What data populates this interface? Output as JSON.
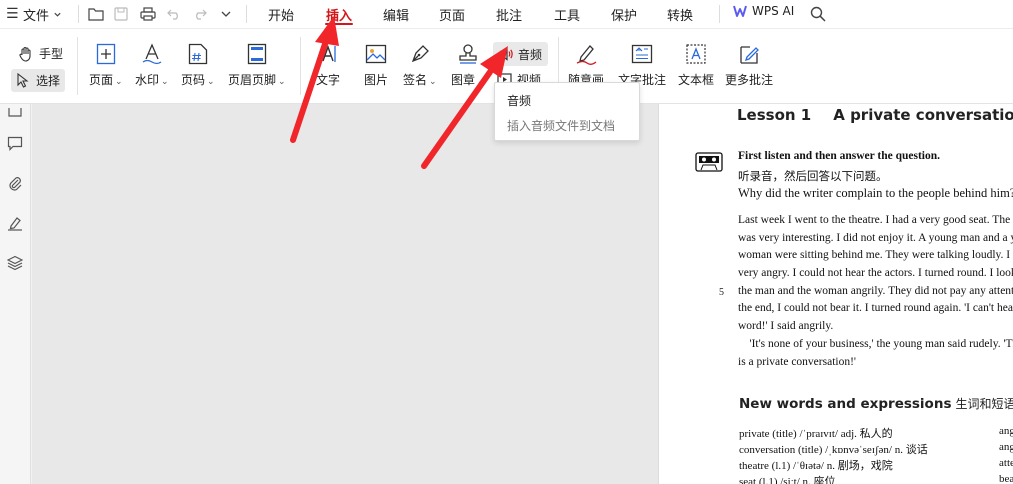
{
  "menubar": {
    "file_label": "文件",
    "tabs": [
      "开始",
      "插入",
      "编辑",
      "页面",
      "批注",
      "工具",
      "保护",
      "转换"
    ],
    "active_tab": "插入",
    "wps_ai_label": "WPS AI"
  },
  "ribbon": {
    "hand_tool": "手型",
    "select_tool": "选择",
    "page": "页面",
    "watermark": "水印",
    "page_number": "页码",
    "header_footer": "页眉页脚",
    "text": "文字",
    "image": "图片",
    "signature": "签名",
    "stamp": "图章",
    "audio": "音频",
    "video": "视频",
    "freehand": "随意画",
    "text_annotation": "文字批注",
    "text_box": "文本框",
    "more_annotations": "更多批注"
  },
  "tooltip": {
    "title": "音频",
    "description": "插入音频文件到文档"
  },
  "document": {
    "lesson_number": "Lesson 1",
    "lesson_title": "A private conversation",
    "instruction_en": "First listen and then answer the question.",
    "instruction_zh": "听录音，然后回答以下问题。",
    "question": "Why did the writer complain to the people behind him?",
    "body_lines": [
      "Last week I went to the theatre. I had a very good seat. The play",
      "was very interesting. I did not enjoy it. A young man and a young",
      "woman were sitting behind me. They were talking loudly. I got",
      "very angry. I could not hear the actors. I turned round. I looked at",
      "the man and the woman angrily. They did not pay any attention. In",
      "the end, I could not bear it. I turned round again. 'I can't hear a",
      "word!' I said angrily.",
      "    'It's none of your business,' the young man said rudely. 'This",
      "is a private conversation!'"
    ],
    "line_number": "5",
    "section_title": "New words and expressions",
    "section_title_zh": "生词和短语",
    "vocab_left": [
      "private (title) /ˈpraɪvɪt/ adj. 私人的",
      "conversation (title) /ˌkɒnvəˈseɪʃən/ n. 谈话",
      "theatre (l.1) /ˈθɪətə/ n. 剧场，戏院",
      "seat (l.1) /siːt/ n. 座位"
    ],
    "vocab_right": [
      "ang",
      "ang",
      "atte",
      "bea"
    ]
  },
  "colors": {
    "accent_red": "#d3171b",
    "arrow_red": "#f0262a"
  }
}
